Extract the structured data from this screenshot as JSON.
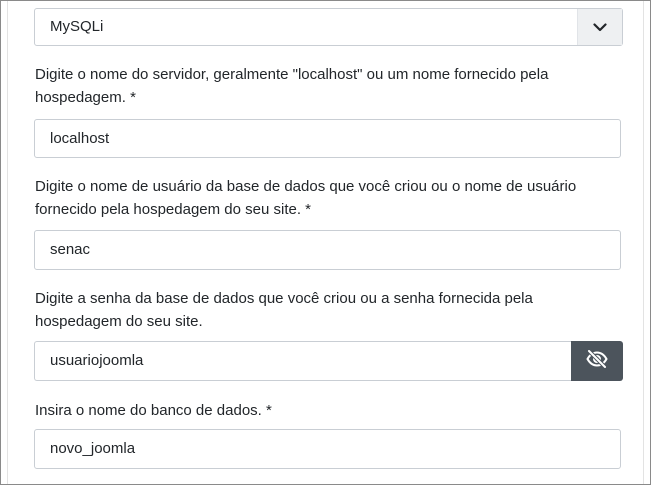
{
  "db_type": {
    "selected": "MySQLi"
  },
  "host": {
    "label": "Digite o nome do servidor, geralmente \"localhost\" ou um nome fornecido pela hospedagem. *",
    "value": "localhost"
  },
  "db_user": {
    "label": "Digite o nome de usuário da base de dados que você criou ou o nome de usuário fornecido pela hospedagem do seu site. *",
    "value": "senac"
  },
  "db_password": {
    "label": "Digite a senha da base de dados que você criou ou a senha fornecida pela hospedagem do seu site.",
    "value": "usuariojoomla",
    "toggle_icon": "eye-slash-icon"
  },
  "db_name": {
    "label": "Insira o nome do banco de dados. *",
    "value": "novo_joomla"
  }
}
